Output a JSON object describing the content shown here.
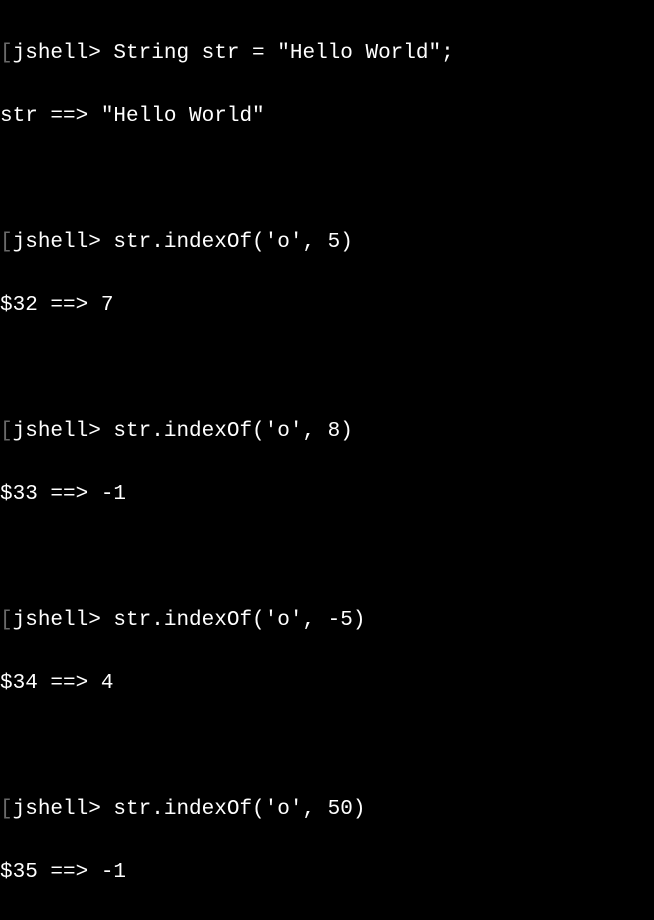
{
  "terminal": {
    "prompt": "jshell>",
    "bracket_open": "[",
    "entries": [
      {
        "input": " String str = \"Hello World\";",
        "output": "str ==> \"Hello World\""
      },
      {
        "input": " str.indexOf('o', 5)",
        "output": "$32 ==> 7"
      },
      {
        "input": " str.indexOf('o', 8)",
        "output": "$33 ==> -1"
      },
      {
        "input": " str.indexOf('o', -5)",
        "output": "$34 ==> 4"
      },
      {
        "input": " str.indexOf('o', 50)",
        "output": "$35 ==> -1"
      }
    ]
  }
}
